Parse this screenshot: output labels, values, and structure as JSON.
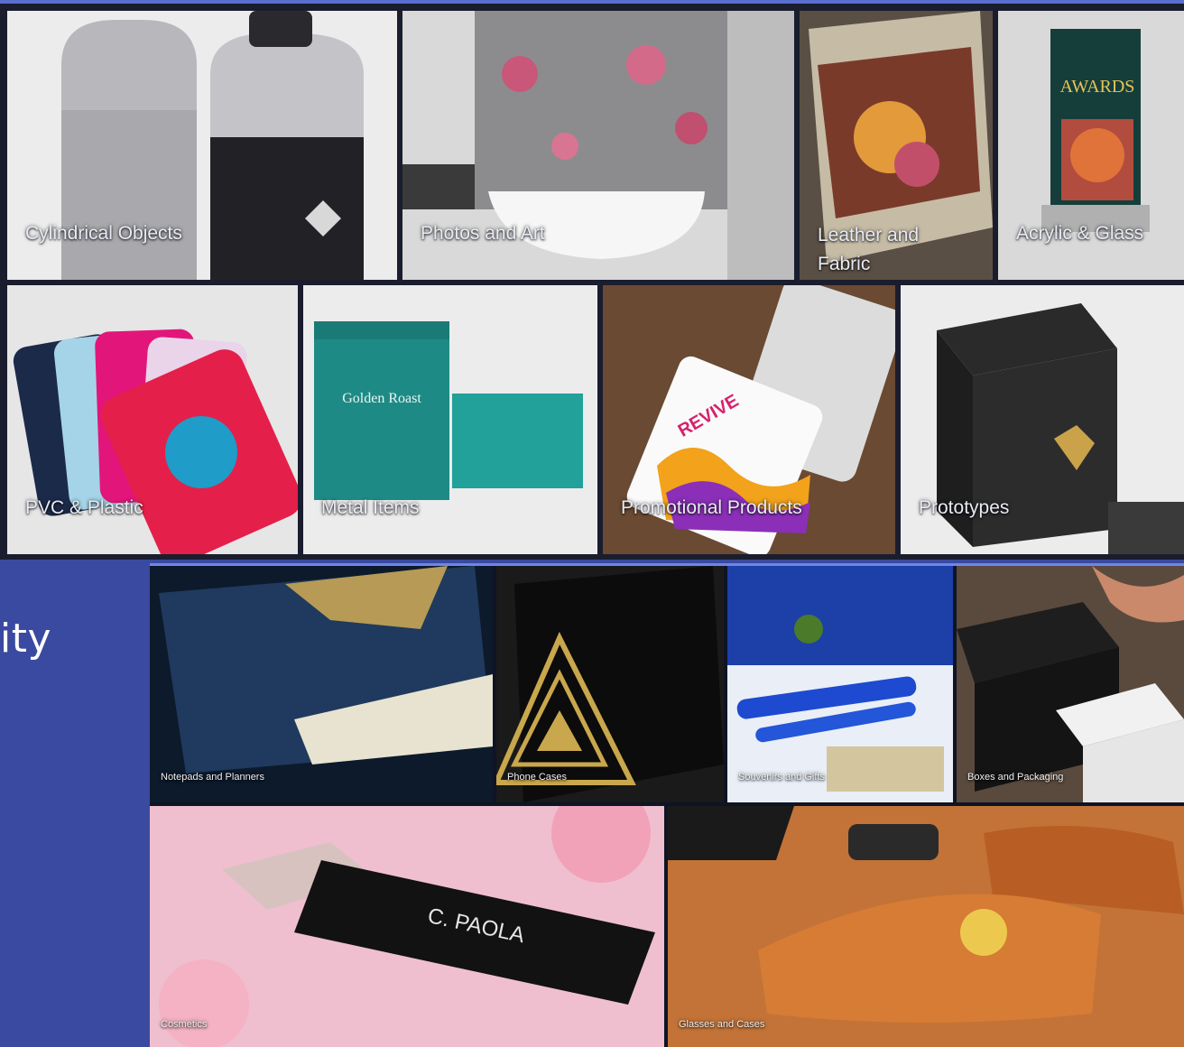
{
  "top_grid": {
    "row1": [
      {
        "label": "Cylindrical Objects"
      },
      {
        "label": "Photos and Art"
      },
      {
        "label": "Leather and Fabric"
      },
      {
        "label": "Acrylic & Glass"
      }
    ],
    "row2": [
      {
        "label": "PVC & Plastic"
      },
      {
        "label": "Metal Items"
      },
      {
        "label": "Promotional Products"
      },
      {
        "label": "Prototypes"
      }
    ]
  },
  "side_text": "ity",
  "bottom_grid": {
    "row1": [
      {
        "label": "Notepads and Planners"
      },
      {
        "label": "Phone Cases"
      },
      {
        "label": "Souvenirs and Gifts"
      },
      {
        "label": "Boxes and Packaging"
      }
    ],
    "row2": [
      {
        "label": "Cosmetics"
      },
      {
        "label": "Glasses and Cases"
      }
    ]
  },
  "product_text": {
    "book_title": "AWARDS",
    "tin_brand": "Golden Roast",
    "power_bank_brand": "REVIVE",
    "lipstick_brand": "C. PAOLA"
  },
  "colors": {
    "frame": "#1a1d2e",
    "page_background": "#3a4aa0",
    "label_text": "#e8ebf5"
  }
}
